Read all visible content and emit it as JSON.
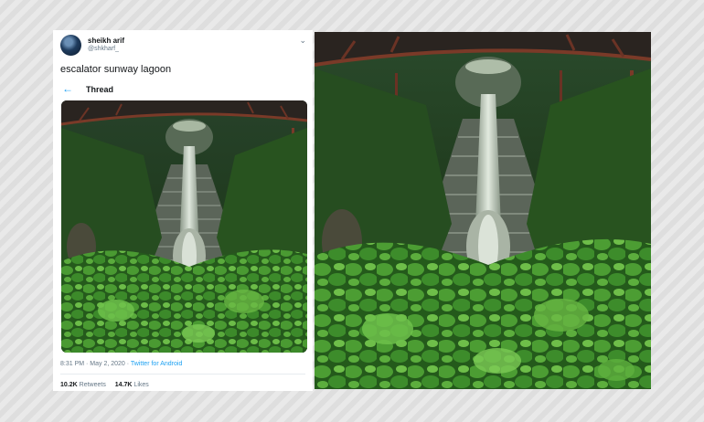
{
  "tweet": {
    "display_name": "sheikh arif",
    "handle": "@shkharf_",
    "text": "escalator sunway lagoon",
    "thread_label": "Thread",
    "time": "8:31 PM · May 2, 2020 · ",
    "source": "Twitter for Android",
    "retweets_count": "10.2K",
    "retweets_label": "Retweets",
    "likes_count": "14.7K",
    "likes_label": "Likes"
  },
  "icons": {
    "back": "arrow-left-icon",
    "menu": "chevron-down-icon"
  },
  "colors": {
    "accent": "#1da1f2",
    "text": "#14171a",
    "muted": "#657786",
    "foliage": "#2f6b22"
  }
}
